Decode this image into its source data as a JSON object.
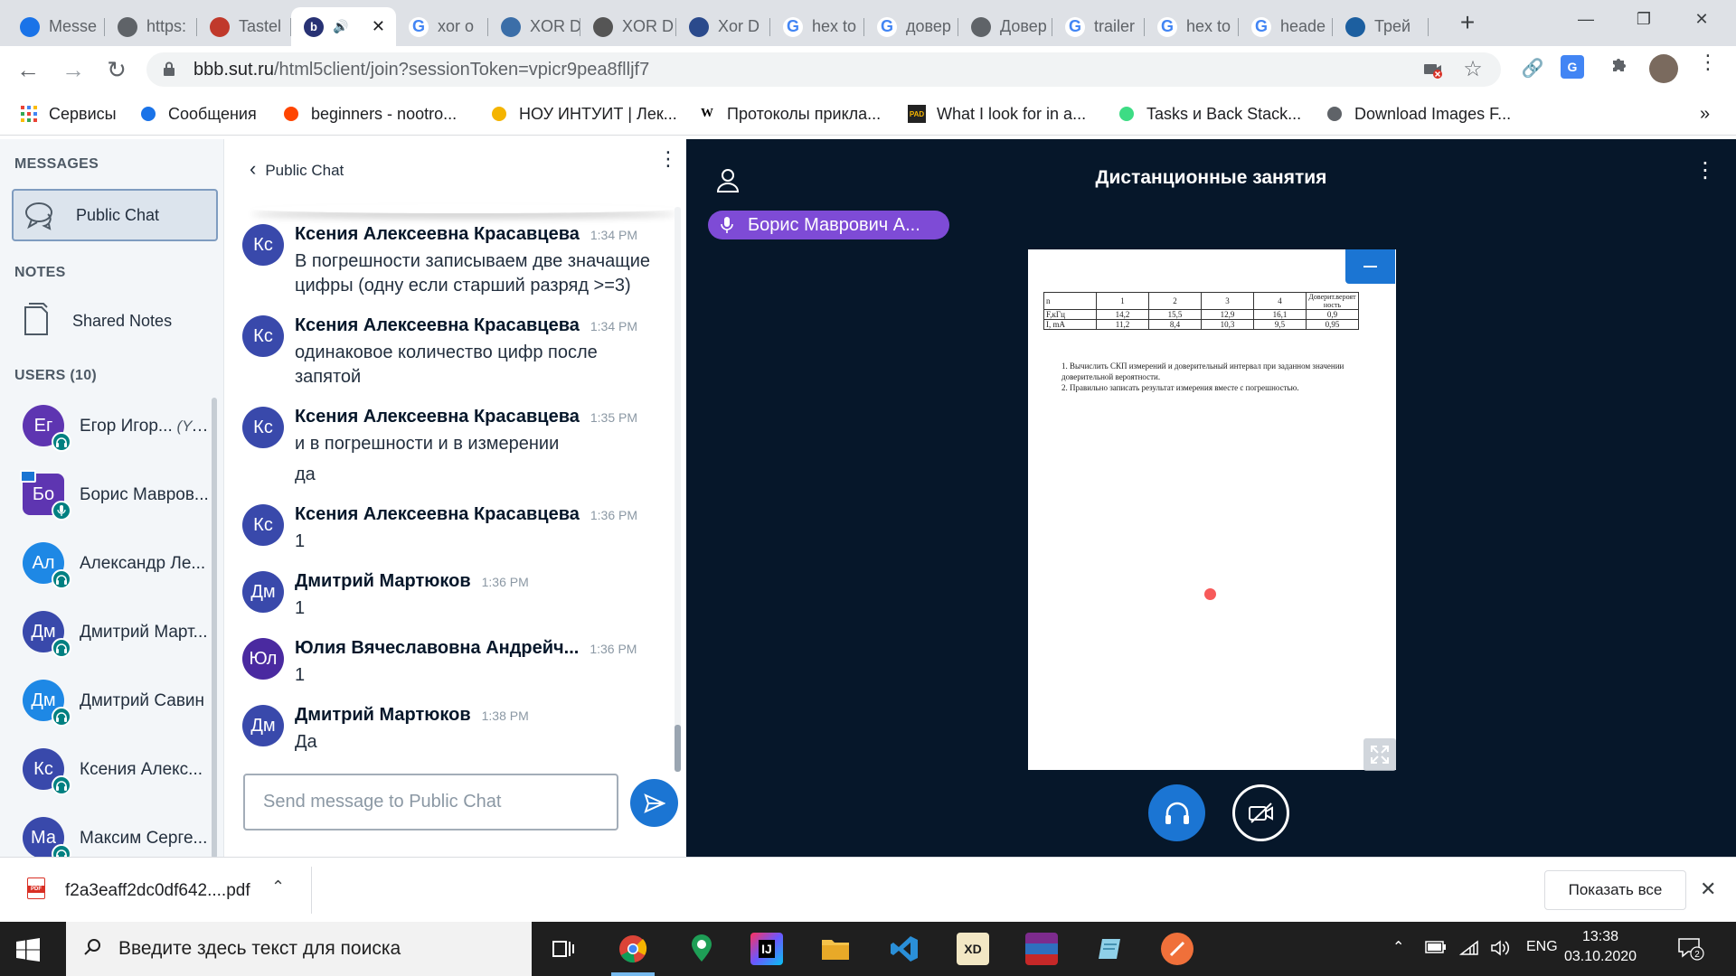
{
  "browser": {
    "tabs": [
      {
        "label": "Messe",
        "fav": "messages-icon",
        "color": "#1a73e8"
      },
      {
        "label": "https:",
        "fav": "globe-icon",
        "color": "#5f6368"
      },
      {
        "label": "Tastel",
        "fav": "tastel-icon",
        "color": "#c0392b"
      },
      {
        "label": "",
        "fav": "bbb-icon",
        "color": "#283274"
      },
      {
        "label": "xor o",
        "fav": "google-icon",
        "color": "#4285f4"
      },
      {
        "label": "XOR D",
        "fav": "xor-icon",
        "color": "#3b6ea8"
      },
      {
        "label": "XOR D",
        "fav": "binary-icon",
        "color": "#555"
      },
      {
        "label": "Xor D",
        "fav": "xor-circle-icon",
        "color": "#2b4a8c"
      },
      {
        "label": "hex to",
        "fav": "google-icon",
        "color": "#4285f4"
      },
      {
        "label": "довер",
        "fav": "google-icon",
        "color": "#4285f4"
      },
      {
        "label": "Довер",
        "fav": "globe-icon",
        "color": "#5f6368"
      },
      {
        "label": "trailer",
        "fav": "google-icon",
        "color": "#4285f4"
      },
      {
        "label": "hex to",
        "fav": "google-icon",
        "color": "#4285f4"
      },
      {
        "label": "heade",
        "fav": "google-icon",
        "color": "#4285f4"
      },
      {
        "label": "Трей",
        "fav": "trey-icon",
        "color": "#1c5fa0"
      }
    ],
    "url_main": "bbb.sut.ru",
    "url_rest": "/html5client/join?sessionToken=vpicr9pea8flljf7",
    "bookmarks": [
      {
        "label": "Сервисы",
        "icon": "apps-grid-icon"
      },
      {
        "label": "Сообщения",
        "icon": "messages-icon"
      },
      {
        "label": "beginners - nootro...",
        "icon": "reddit-icon"
      },
      {
        "label": "НОУ ИНТУИТ | Лек...",
        "icon": "intuit-icon"
      },
      {
        "label": "Протоколы прикла...",
        "icon": "wikipedia-icon"
      },
      {
        "label": "What I look for in a...",
        "icon": "pad-icon"
      },
      {
        "label": "Tasks и Back Stack...",
        "icon": "android-icon"
      },
      {
        "label": "Download Images F...",
        "icon": "globe-icon"
      }
    ],
    "bookmarks_more": "»"
  },
  "bbb": {
    "messages_heading": "MESSAGES",
    "public_chat_item": "Public Chat",
    "notes_heading": "NOTES",
    "shared_notes": "Shared Notes",
    "users_heading": "USERS (10)",
    "users": [
      {
        "initials": "Ег",
        "name": "Егор Игор...",
        "you": "(You)",
        "color": "#5e35b1",
        "badge": "headset-icon"
      },
      {
        "initials": "Бо",
        "name": "Борис Мавров...",
        "you": "",
        "color": "#5e35b1",
        "badge": "mic-icon",
        "presenter": true
      },
      {
        "initials": "Ал",
        "name": "Александр Ле...",
        "you": "",
        "color": "#1e88e5",
        "badge": "headset-icon"
      },
      {
        "initials": "Дм",
        "name": "Дмитрий Март...",
        "you": "",
        "color": "#3949ab",
        "badge": "headset-icon"
      },
      {
        "initials": "Дм",
        "name": "Дмитрий Савин",
        "you": "",
        "color": "#1e88e5",
        "badge": "headset-icon"
      },
      {
        "initials": "Кс",
        "name": "Ксения Алекс...",
        "you": "",
        "color": "#3949ab",
        "badge": "headset-icon"
      },
      {
        "initials": "Ма",
        "name": "Максим Серге...",
        "you": "",
        "color": "#3949ab",
        "badge": "headset-icon"
      }
    ],
    "chat": {
      "title": "Public Chat",
      "messages": [
        {
          "initials": "Кс",
          "color": "#3949ab",
          "name": "Ксения Алексеевна Красавцева",
          "time": "1:34 PM",
          "text": "В погрешности записываем две значащие цифры (одну если старший разряд >=3)"
        },
        {
          "initials": "Кс",
          "color": "#3949ab",
          "name": "Ксения Алексеевна Красавцева",
          "time": "1:34 PM",
          "text": "одинаковое количество цифр после запятой"
        },
        {
          "initials": "Кс",
          "color": "#3949ab",
          "name": "Ксения Алексеевна Красавцева",
          "time": "1:35 PM",
          "text": "и в погрешности и в измерении",
          "text2": "да"
        },
        {
          "initials": "Кс",
          "color": "#3949ab",
          "name": "Ксения Алексеевна Красавцева",
          "time": "1:36 PM",
          "text": "1"
        },
        {
          "initials": "Дм",
          "color": "#3949ab",
          "name": "Дмитрий Мартюков",
          "time": "1:36 PM",
          "text": "1"
        },
        {
          "initials": "Юл",
          "color": "#4a2aa0",
          "name": "Юлия Вячеславовна Андрейч...",
          "time": "1:36 PM",
          "text": "1"
        },
        {
          "initials": "Дм",
          "color": "#3949ab",
          "name": "Дмитрий Мартюков",
          "time": "1:38 PM",
          "text": "Да"
        }
      ],
      "input_placeholder": "Send message to Public Chat"
    },
    "presentation": {
      "title": "Дистанционные занятия",
      "talking": "Борис Маврович А...",
      "table": {
        "header": [
          "n",
          "1",
          "2",
          "3",
          "4",
          "Доверит.вероятность"
        ],
        "rows": [
          [
            "F,кГц",
            "14,2",
            "15,5",
            "12,9",
            "16,1",
            "0,9"
          ],
          [
            "I, mA",
            "11,2",
            "8,4",
            "10,3",
            "9,5",
            "0,95"
          ]
        ]
      },
      "tasks": [
        "1.   Вычислить СКП измерений и доверительный интервал при заданном значении доверительной вероятности.",
        "2.   Правильно записать  результат измерения вместе с погрешностью."
      ]
    }
  },
  "downloads": {
    "file": "f2a3eaff2dc0df642....pdf",
    "show_all": "Показать все"
  },
  "taskbar": {
    "search_placeholder": "Введите здесь текст для поиска",
    "lang": "ENG",
    "time": "13:38",
    "date": "03.10.2020",
    "notifications": "2"
  }
}
